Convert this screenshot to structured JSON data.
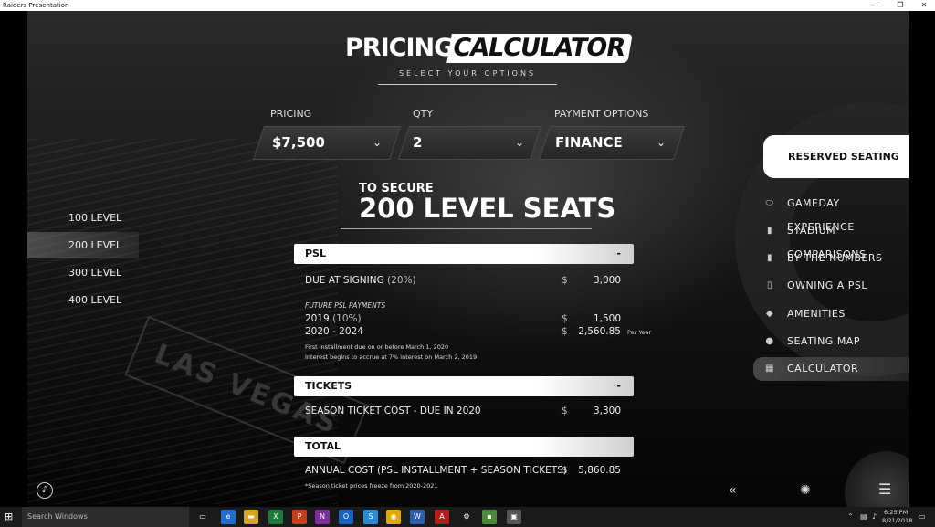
{
  "window": {
    "title": "Raiders Presentation",
    "minimize": "—",
    "maximize": "❐",
    "close": "✕"
  },
  "header": {
    "logo_white": "PRICING",
    "logo_black": "CALCULATOR",
    "subtitle": "SELECT YOUR OPTIONS"
  },
  "filters": {
    "pricing": {
      "label": "PRICING",
      "value": "$7,500"
    },
    "qty": {
      "label": "QTY",
      "value": "2"
    },
    "payment": {
      "label": "PAYMENT OPTIONS",
      "value": "FINANCE"
    }
  },
  "heading": {
    "pre": "TO SECURE",
    "title": "200 LEVEL SEATS"
  },
  "levels": [
    {
      "label": "100 LEVEL",
      "active": false
    },
    {
      "label": "200 LEVEL",
      "active": true
    },
    {
      "label": "300 LEVEL",
      "active": false
    },
    {
      "label": "400 LEVEL",
      "active": false
    }
  ],
  "psl": {
    "title": "PSL",
    "toggle": "-",
    "due_label": "DUE AT SIGNING",
    "due_pct": "(20%)",
    "due_amount": "3,000",
    "future_label": "FUTURE PSL PAYMENTS",
    "y2019_label": "2019",
    "y2019_pct": "(10%)",
    "y2019_amount": "1,500",
    "y2020_label": "2020 - 2024",
    "y2020_amount": "2,560.85",
    "per_year": "Per Year",
    "note1": "First installment due on or before March 1, 2020",
    "note2": "Interest begins to accrue at 7% interest on March 2, 2019"
  },
  "tickets": {
    "title": "TICKETS",
    "toggle": "-",
    "label": "SEASON TICKET COST - DUE IN 2020",
    "amount": "3,300"
  },
  "total": {
    "title": "TOTAL",
    "label": "ANNUAL COST (PSL INSTALLMENT + SEASON TICKETS)",
    "amount": "5,860.85",
    "note": "*Season ticket prices freeze from 2020-2021"
  },
  "currency": "$",
  "right_nav": {
    "header": "RESERVED SEATING",
    "items": [
      {
        "label": "GAMEDAY EXPERIENCE",
        "icon": "football-icon"
      },
      {
        "label": "STADIUM COMPARISONS",
        "icon": "book-icon"
      },
      {
        "label": "BY THE NUMBERS",
        "icon": "book-icon"
      },
      {
        "label": "OWNING A PSL",
        "icon": "document-icon"
      },
      {
        "label": "AMENITIES",
        "icon": "tag-icon"
      },
      {
        "label": "SEATING MAP",
        "icon": "check-circle-icon"
      },
      {
        "label": "CALCULATOR",
        "icon": "calculator-icon",
        "active": true
      }
    ]
  },
  "taskbar": {
    "search_placeholder": "Search Windows",
    "time": "6:25 PM",
    "date": "8/21/2018"
  }
}
